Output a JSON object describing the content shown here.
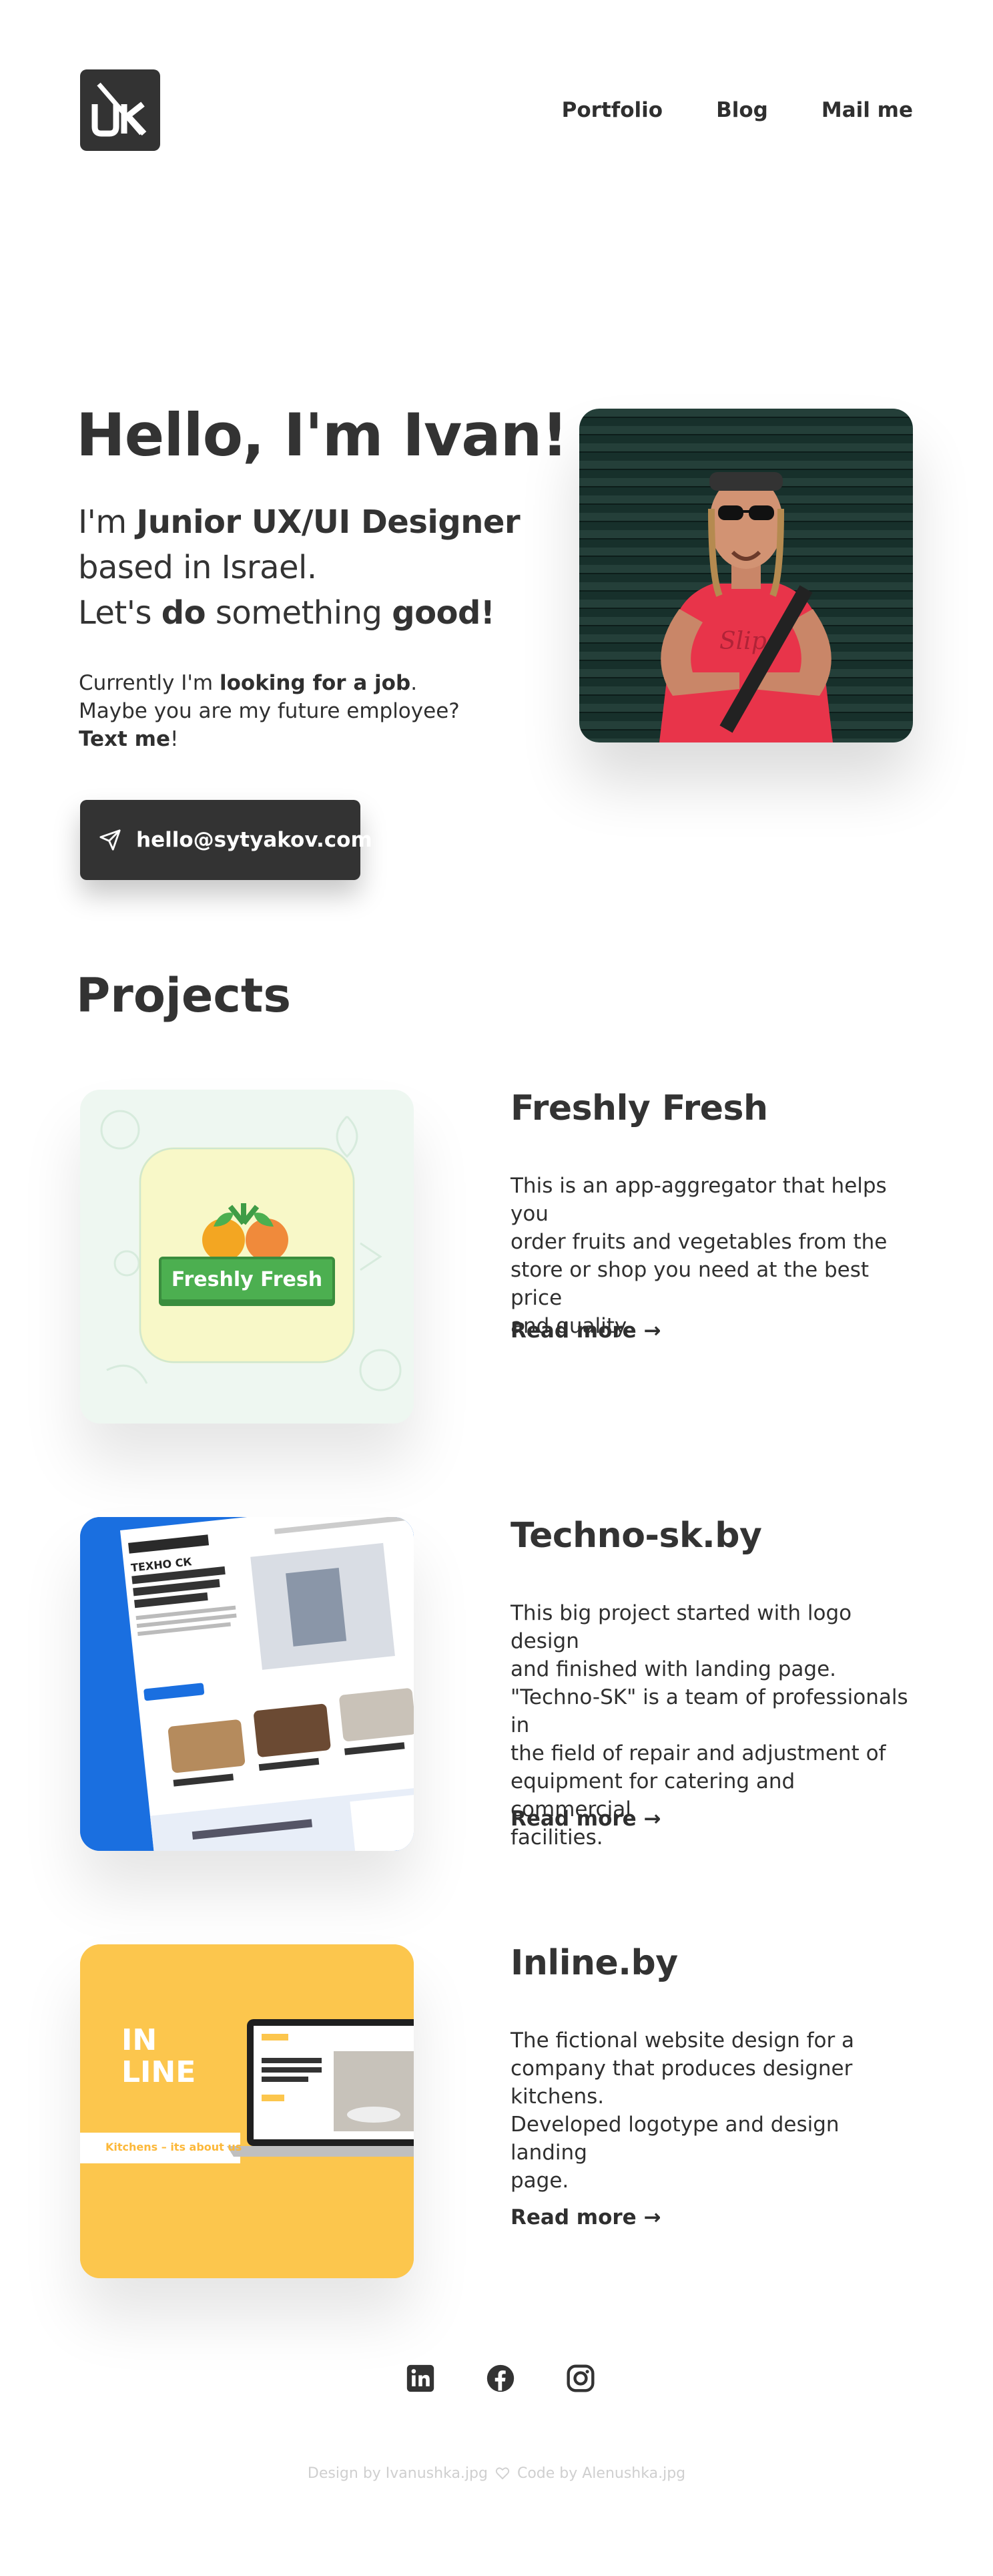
{
  "header": {
    "logo_alt": "DK",
    "nav": [
      {
        "label": "Portfolio"
      },
      {
        "label": "Blog"
      },
      {
        "label": "Mail me"
      }
    ]
  },
  "hero": {
    "title": "Hello, I'm Ivan!",
    "line1_pre": "I'm ",
    "line1_bold": "Junior UX/UI Designer",
    "line2": "based in Israel.",
    "line3_pre": "Let's ",
    "line3_bold1": "do",
    "line3_mid": " something ",
    "line3_bold2": "good!",
    "note1_pre": "Currently I'm ",
    "note1_bold": "looking for a job",
    "note1_post": ".",
    "note2": "Maybe you are my future  employee?",
    "note3_bold": "Text me",
    "note3_post": "!",
    "email_button": "hello@sytyakov.com"
  },
  "projects": {
    "title": "Projects",
    "items": [
      {
        "name": "Freshly Fresh",
        "card_label": "Freshly Fresh",
        "desc_lines": [
          "This is an app-aggregator that helps you",
          "order fruits and vegetables from the",
          "store or shop you need at the best price",
          "and quality."
        ],
        "read_more": "Read more →"
      },
      {
        "name": "Techno-sk.by",
        "card_label": "ТЕХНО СК",
        "desc_lines": [
          "This big project started with logo design",
          "and finished with landing page.",
          "\"Techno-SK\" is a team of professionals in",
          "the field of repair and adjustment of",
          "equipment for catering and commercial",
          "facilities."
        ],
        "read_more": "Read more →"
      },
      {
        "name": "Inline.by",
        "card_label_1": "IN",
        "card_label_2": "LINE",
        "card_tagline": "Kitchens – its about us",
        "desc_lines": [
          "The fictional website design for a",
          "company that produces designer",
          "kitchens.",
          "Developed logotype and design landing",
          "page."
        ],
        "read_more": "Read more →"
      }
    ]
  },
  "footer": {
    "socials": [
      {
        "icon": "linkedin-icon"
      },
      {
        "icon": "facebook-icon"
      },
      {
        "icon": "instagram-icon"
      }
    ],
    "credit_design": "Design by Ivanushka.jpg",
    "credit_code": "Code by Alenushka.jpg"
  },
  "colors": {
    "dark": "#333333",
    "text": "#2f2f2f",
    "credits": "#cfcfcf",
    "techno_blue": "#1a6fe0",
    "inline_yellow": "#fcc64d",
    "fresh_green": "#4caf50"
  }
}
